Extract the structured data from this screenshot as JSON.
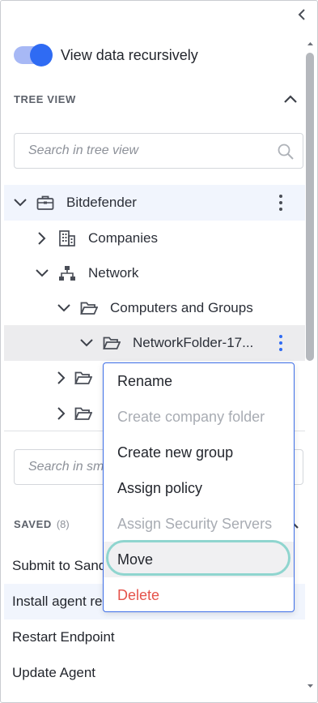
{
  "toggle": {
    "label": "View data recursively",
    "on": true
  },
  "tree_view": {
    "title": "TREE VIEW",
    "search_placeholder": "Search in tree view",
    "nodes": [
      {
        "label": "Bitdefender"
      },
      {
        "label": "Companies"
      },
      {
        "label": "Network"
      },
      {
        "label": "Computers and Groups"
      },
      {
        "label": "NetworkFolder-17..."
      }
    ]
  },
  "saved": {
    "search_placeholder": "Search in smart tasks",
    "title": "SAVED",
    "count": "(8)",
    "items": [
      {
        "label": "Submit to Sandbox Analyzer"
      },
      {
        "label": "Install agent remotely"
      },
      {
        "label": "Restart Endpoint"
      },
      {
        "label": "Update Agent"
      }
    ]
  },
  "context_menu": {
    "items": [
      {
        "label": "Rename",
        "state": "enabled"
      },
      {
        "label": "Create company folder",
        "state": "disabled"
      },
      {
        "label": "Create new group",
        "state": "enabled"
      },
      {
        "label": "Assign policy",
        "state": "enabled"
      },
      {
        "label": "Assign Security Servers",
        "state": "disabled"
      },
      {
        "label": "Move",
        "state": "focused"
      },
      {
        "label": "Delete",
        "state": "danger"
      }
    ]
  },
  "colors": {
    "accent": "#2f6bf3",
    "danger": "#e5534b",
    "focus_ring": "#8fd5cf"
  }
}
